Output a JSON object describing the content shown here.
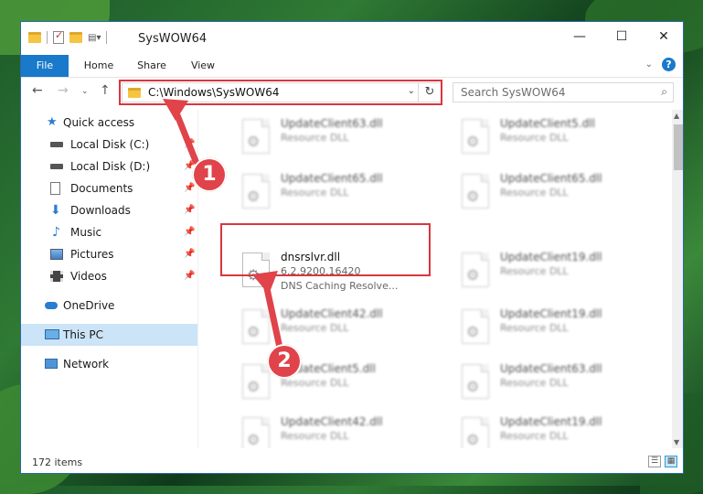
{
  "window": {
    "title": "SysWOW64",
    "controls": {
      "minimize": "—",
      "maximize": "☐",
      "close": "✕"
    }
  },
  "ribbon": {
    "tabs": [
      "File",
      "Home",
      "Share",
      "View"
    ],
    "help": "?"
  },
  "address": {
    "path": "C:\\Windows\\SysWOW64"
  },
  "search": {
    "placeholder": "Search SysWOW64"
  },
  "sidebar": {
    "items": [
      {
        "label": "Quick access",
        "icon": "star-icon"
      },
      {
        "label": "Local Disk (C:)",
        "icon": "drive-icon",
        "pinned": true
      },
      {
        "label": "Local Disk (D:)",
        "icon": "drive-icon",
        "pinned": true
      },
      {
        "label": "Documents",
        "icon": "documents-icon",
        "pinned": true
      },
      {
        "label": "Downloads",
        "icon": "download-icon",
        "pinned": true
      },
      {
        "label": "Music",
        "icon": "music-icon",
        "pinned": true
      },
      {
        "label": "Pictures",
        "icon": "pictures-icon",
        "pinned": true
      },
      {
        "label": "Videos",
        "icon": "videos-icon",
        "pinned": true
      },
      {
        "label": "OneDrive",
        "icon": "cloud-icon"
      },
      {
        "label": "This PC",
        "icon": "computer-icon",
        "selected": true
      },
      {
        "label": "Network",
        "icon": "network-icon"
      }
    ]
  },
  "files": {
    "left": [
      {
        "name": "UpdateClient63.dll",
        "type": "Resource DLL"
      },
      {
        "name": "UpdateClient65.dll",
        "type": "Resource DLL"
      },
      {
        "name": "dnsrslvr.dll",
        "version": "6.2.9200.16420",
        "type": "DNS Caching Resolve..."
      },
      {
        "name": "UpdateClient42.dll",
        "type": "Resource DLL"
      },
      {
        "name": "UpdateClient5.dll",
        "type": "Resource DLL"
      },
      {
        "name": "UpdateClient42.dll",
        "type": "Resource DLL"
      }
    ],
    "right": [
      {
        "name": "UpdateClient5.dll",
        "type": "Resource DLL"
      },
      {
        "name": "UpdateClient65.dll",
        "type": "Resource DLL"
      },
      {
        "name": "UpdateClient19.dll",
        "type": "Resource DLL"
      },
      {
        "name": "UpdateClient19.dll",
        "type": "Resource DLL"
      },
      {
        "name": "UpdateClient63.dll",
        "type": "Resource DLL"
      },
      {
        "name": "UpdateClient19.dll",
        "type": "Resource DLL"
      }
    ]
  },
  "status": {
    "count": "172 items"
  },
  "annotations": {
    "step1": "1",
    "step2": "2",
    "color": "#e0434a"
  }
}
